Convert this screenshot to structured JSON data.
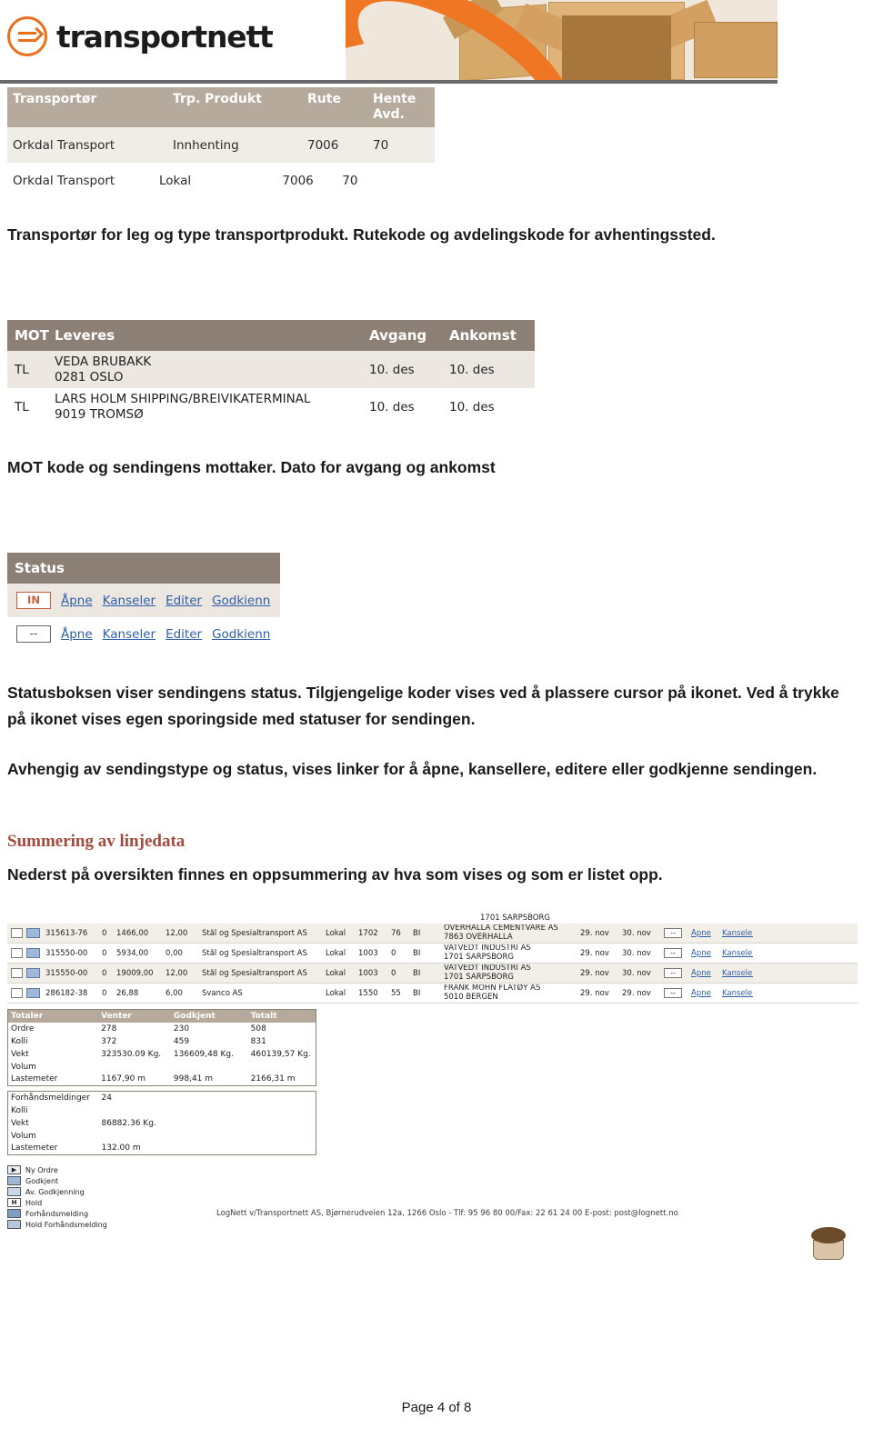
{
  "header": {
    "logo_text": "transportnett",
    "logo_icon": "circle-arrows-icon"
  },
  "transportor_table": {
    "columns": [
      "Transportør",
      "Trp. Produkt",
      "Rute",
      "Hente Avd."
    ],
    "col_hente_line1": "Hente",
    "col_hente_line2": "Avd.",
    "rows": [
      {
        "transportor": "Orkdal Transport",
        "produkt": "Innhenting",
        "rute": "7006",
        "avd": "70"
      },
      {
        "transportor": "Orkdal Transport",
        "produkt": "Lokal",
        "rute": "7006",
        "avd": "70"
      }
    ]
  },
  "paragraphs": {
    "transportor": "Transportør for leg og type transportprodukt. Rutekode og avdelingskode for avhentingssted.",
    "mot": "MOT kode og sendingens mottaker. Dato for avgang og ankomst",
    "status": "Statusboksen viser sendingens status. Tilgjengelige koder vises ved å plassere cursor på ikonet. Ved å trykke på ikonet vises egen sporingside med statuser for sendingen.",
    "avhengig": "Avhengig av sendingstype og status, vises linker for å åpne, kansellere, editere eller godkjenne sendingen.",
    "nederst": "Nederst på oversikten finnes en oppsummering av hva som vises og som er listet opp."
  },
  "mot_table": {
    "columns": [
      "MOT",
      "Leveres",
      "Avgang",
      "Ankomst"
    ],
    "rows": [
      {
        "mot": "TL",
        "lev1": "VEDA BRUBAKK",
        "lev2": "0281 OSLO",
        "avgang": "10. des",
        "ankomst": "10. des"
      },
      {
        "mot": "TL",
        "lev1": "LARS HOLM SHIPPING/BREIVIKATERMINAL",
        "lev2": "9019 TROMSØ",
        "avgang": "10. des",
        "ankomst": "10. des"
      }
    ]
  },
  "status_box": {
    "title": "Status",
    "rows": [
      {
        "badge": "IN",
        "links": [
          "Åpne",
          "Kanseler",
          "Editer",
          "Godkienn"
        ]
      },
      {
        "badge": "--",
        "links": [
          "Åpne",
          "Kanseler",
          "Editer",
          "Godkienn"
        ]
      }
    ]
  },
  "summering": {
    "heading": "Summering av linjedata"
  },
  "bottom_grid": {
    "top_partial_text": "1701 SARPSBORG",
    "rows": [
      {
        "ordre": "315613-76",
        "n0": "0",
        "sum": "1466,00",
        "vekt": "12,00",
        "navn": "Stål og Spesialtransport AS",
        "lokal": "Lokal",
        "rute": "1702",
        "avd": "76",
        "bi": "BI",
        "mott1": "OVERHALLA CEMENTVARE AS",
        "mott2": "7863 OVERHALLA",
        "d1": "29. nov",
        "d2": "30. nov",
        "stat": "--",
        "link1": "Åpne",
        "link2": "Kanseler"
      },
      {
        "ordre": "315550-00",
        "n0": "0",
        "sum": "5934,00",
        "vekt": "0,00",
        "navn": "Stål og Spesialtransport AS",
        "lokal": "Lokal",
        "rute": "1003",
        "avd": "0",
        "bi": "BI",
        "mott1": "VATVEDT INDUSTRI AS",
        "mott2": "1701 SARPSBORG",
        "d1": "29. nov",
        "d2": "30. nov",
        "stat": "--",
        "link1": "Åpne",
        "link2": "Kanseler"
      },
      {
        "ordre": "315550-00",
        "n0": "0",
        "sum": "19009,00",
        "vekt": "12,00",
        "navn": "Stål og Spesialtransport AS",
        "lokal": "Lokal",
        "rute": "1003",
        "avd": "0",
        "bi": "BI",
        "mott1": "VATVEDT INDUSTRI AS",
        "mott2": "1701 SARPSBORG",
        "d1": "29. nov",
        "d2": "30. nov",
        "stat": "--",
        "link1": "Åpne",
        "link2": "Kanseler"
      },
      {
        "ordre": "286182-38",
        "n0": "0",
        "sum": "26,88",
        "vekt": "6,00",
        "navn": "Svanco AS",
        "lokal": "Lokal",
        "rute": "1550",
        "avd": "55",
        "bi": "BI",
        "mott1": "FRANK MOHN FLATØY AS",
        "mott2": "5010 BERGEN",
        "d1": "29. nov",
        "d2": "29. nov",
        "stat": "--",
        "link1": "Åpne",
        "link2": "Kanseler"
      }
    ]
  },
  "totals_table": {
    "columns": [
      "Totaler",
      "Venter",
      "Godkjent",
      "Totalt"
    ],
    "rows": [
      [
        "Ordre",
        "278",
        "230",
        "508"
      ],
      [
        "Kolli",
        "372",
        "459",
        "831"
      ],
      [
        "Vekt",
        "323530.09 Kg.",
        "136609,48 Kg.",
        "460139,57 Kg."
      ],
      [
        "Volum",
        "",
        "",
        ""
      ],
      [
        "Lastemeter",
        "1167,90 m",
        "998,41 m",
        "2166,31 m"
      ]
    ]
  },
  "forhands_table": {
    "rows": [
      [
        "Forhåndsmeldinger",
        "24"
      ],
      [
        "Kolli",
        ""
      ],
      [
        "Vekt",
        "86882.36 Kg."
      ],
      [
        "Volum",
        ""
      ],
      [
        "Lastemeter",
        "132.00 m"
      ]
    ]
  },
  "legend": {
    "items": [
      {
        "symbol": "▶",
        "label": "Ny Ordre"
      },
      {
        "symbol": "",
        "label": "Godkjent"
      },
      {
        "symbol": "",
        "label": "Av. Godkjenning"
      },
      {
        "symbol": "H",
        "label": "Hold"
      },
      {
        "symbol": "",
        "label": "Forhåndsmelding"
      },
      {
        "symbol": "",
        "label": "Hold Forhåndsmelding"
      }
    ]
  },
  "footer": {
    "note": "LogNett v/Transportnett AS, Bjørnerudveien 12a, 1266 Oslo - Tlf: 95 96 80 00/Fax: 22 61 24 00 E-post: post@lognett.no",
    "page": "Page 4 of 8"
  }
}
